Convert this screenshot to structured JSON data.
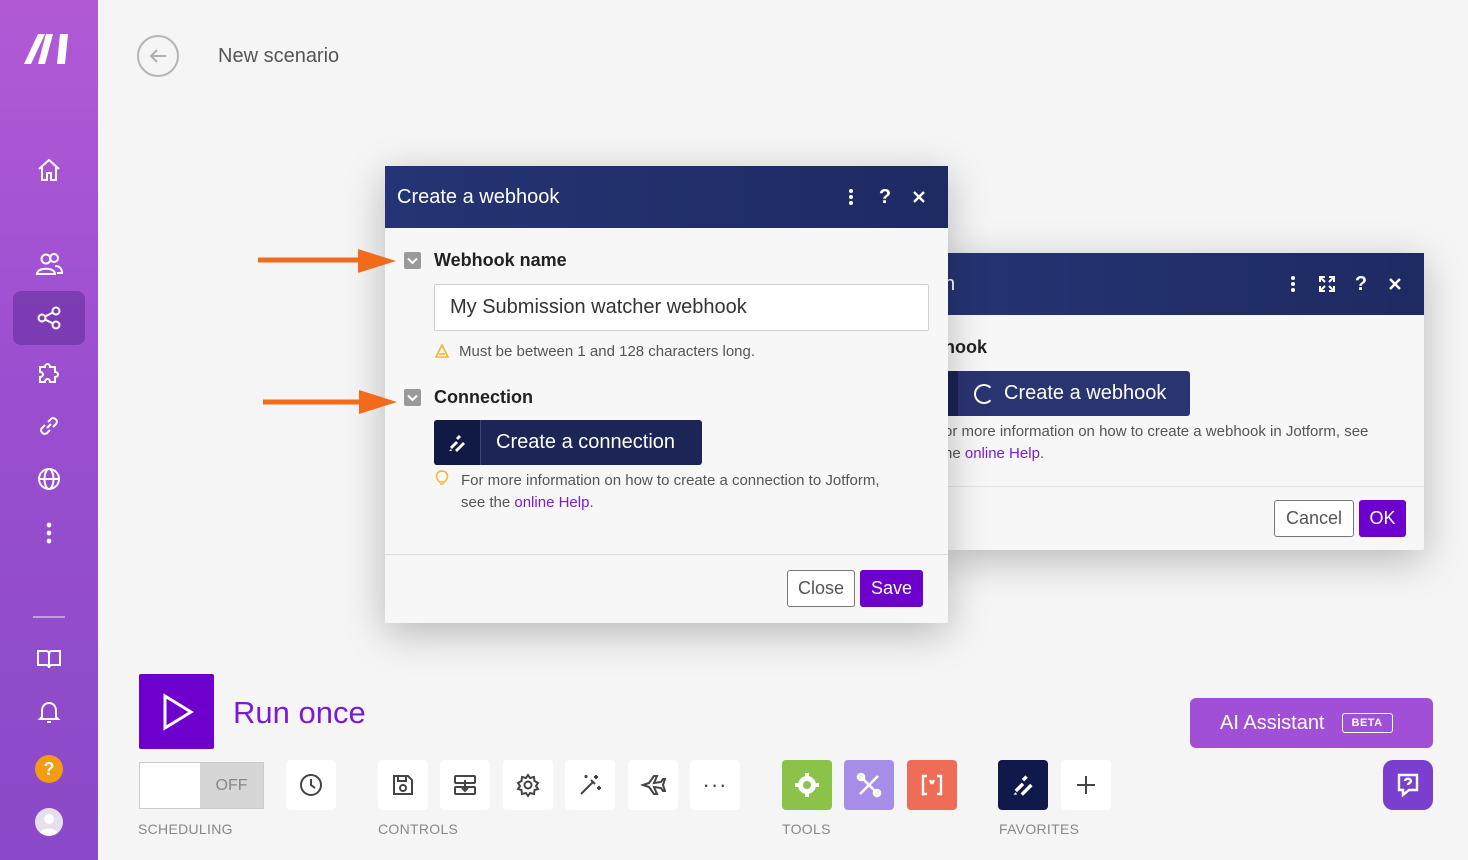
{
  "header": {
    "title": "New scenario"
  },
  "front_modal": {
    "title": "Create a webhook",
    "webhook_name_label": "Webhook name",
    "webhook_name_value": "My Submission watcher webhook",
    "webhook_name_hint": "Must be between 1 and 128 characters long.",
    "connection_label": "Connection",
    "create_connection_label": "Create a connection",
    "connection_hint_1": "For more information on how to create a connection to Jotform,",
    "connection_hint_2_prefix": "see the ",
    "connection_hint_link": "online Help",
    "connection_hint_suffix": ".",
    "close_label": "Close",
    "save_label": "Save"
  },
  "back_modal": {
    "title_fragment": "n",
    "field_label_fragment": "hook",
    "create_webhook_label": "Create a webhook",
    "info_1": "or more information on how to create a webhook in Jotform, see",
    "info_2_prefix": "he ",
    "info_link": "online Help",
    "info_suffix": ".",
    "cancel_label": "Cancel",
    "ok_label": "OK"
  },
  "toolbar": {
    "run_label": "Run once",
    "scheduling_state": "OFF",
    "groups": {
      "scheduling": "SCHEDULING",
      "controls": "CONTROLS",
      "tools": "TOOLS",
      "favorites": "FAVORITES"
    },
    "more_label": "···"
  },
  "ai_assistant": {
    "label": "AI Assistant",
    "badge": "BETA"
  },
  "sidebar": {
    "help_label": "?"
  },
  "colors": {
    "sidebar_top": "#b25ad6",
    "modal_header": "#253474",
    "primary": "#6d00cc",
    "tools_green": "#8bc34a",
    "tools_violet": "#a58de8",
    "tools_red": "#ef6c57",
    "jotform_navy": "#0f1a4a"
  }
}
